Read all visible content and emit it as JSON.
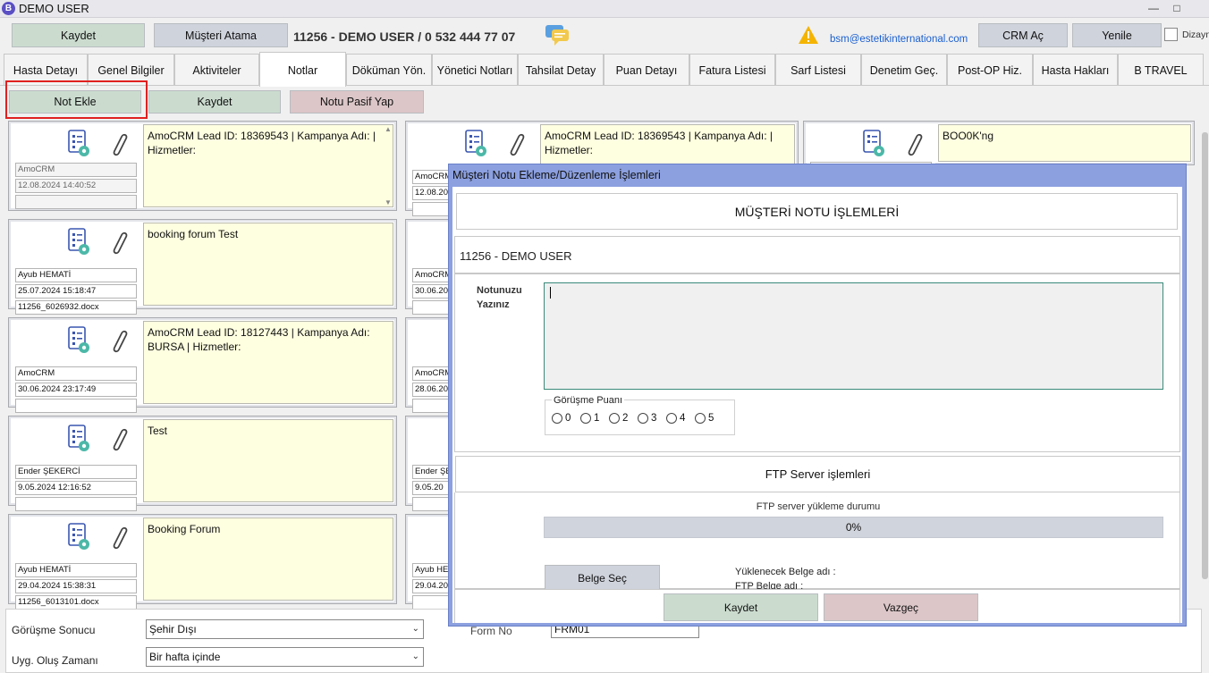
{
  "window": {
    "app_icon": "B",
    "title": "DEMO USER",
    "controls": [
      "—",
      "□"
    ]
  },
  "toolbar": {
    "save_label": "Kaydet",
    "assign_label": "Müşteri Atama",
    "patient_line": "11256  -  DEMO USER  /  0 532 444 77 07",
    "email": "bsm@estetikinternational.com",
    "crm_label": "CRM Aç",
    "refresh_label": "Yenile",
    "dizayn_label": "Dizayn"
  },
  "tabs": [
    {
      "label": "Hasta Detayı"
    },
    {
      "label": "Genel Bilgiler"
    },
    {
      "label": "Aktiviteler"
    },
    {
      "label": "Notlar",
      "active": true
    },
    {
      "label": "Döküman Yön."
    },
    {
      "label": "Yönetici Notları"
    },
    {
      "label": "Tahsilat Detay"
    },
    {
      "label": "Puan Detayı"
    },
    {
      "label": "Fatura Listesi"
    },
    {
      "label": "Sarf Listesi"
    },
    {
      "label": "Denetim Geç."
    },
    {
      "label": "Post-OP Hiz."
    },
    {
      "label": "Hasta Hakları"
    },
    {
      "label": "B TRAVEL"
    }
  ],
  "notes_toolbar": {
    "add_label": "Not Ekle",
    "save_label": "Kaydet",
    "deactivate_label": "Notu Pasif Yap"
  },
  "cards_col1": [
    {
      "author": "AmoCRM",
      "date": "12.08.2024 14:40:52",
      "file": "",
      "note": "AmoCRM Lead ID: 18369543 | Kampanya Adı:  | Hizmetler:"
    },
    {
      "author": "Ayub HEMATİ",
      "date": "25.07.2024 15:18:47",
      "file": "11256_6026932.docx",
      "note": "booking forum  Test"
    },
    {
      "author": "AmoCRM",
      "date": "30.06.2024 23:17:49",
      "file": "",
      "note": "AmoCRM Lead ID: 18127443 | Kampanya Adı: BURSA  | Hizmetler:"
    },
    {
      "author": "Ender ŞEKERCİ",
      "date": "9.05.2024 12:16:52",
      "file": "",
      "note": "Test"
    },
    {
      "author": "Ayub HEMATİ",
      "date": "29.04.2024 15:38:31",
      "file": "11256_6013101.docx",
      "note": "Booking Forum"
    }
  ],
  "cards_col2": [
    {
      "author": "AmoCRM",
      "date": "12.08.20",
      "note": "AmoCRM Lead ID: 18369543 | Kampanya Adı:  | Hizmetler:"
    },
    {
      "author": "AmoCRM",
      "date": "30.06.20",
      "note": ""
    },
    {
      "author": "AmoCRM",
      "date": "28.06.20",
      "note": ""
    },
    {
      "author": "Ender ŞEK",
      "date": "9.05.20",
      "note": ""
    },
    {
      "author": "Ayub HEM",
      "date": "29.04.20",
      "note": ""
    }
  ],
  "card_col3": {
    "note": "BOO0K'ng"
  },
  "bottom": {
    "result_label": "Görüşme Sonucu",
    "result_value": "Şehir Dışı",
    "timing_label": "Uyg. Oluş Zamanı",
    "timing_value": "Bir hafta içinde",
    "form_label": "Form No",
    "form_value": "FRM01"
  },
  "modal": {
    "title": "Müşteri Notu Ekleme/Düzenleme İşlemleri",
    "header": "MÜŞTERİ NOTU İŞLEMLERİ",
    "patient": "11256  -  DEMO USER",
    "note_label": "Notunuzu Yazınız",
    "note_value": "",
    "rating_legend": "Görüşme Puanı",
    "rating_options": [
      "0",
      "1",
      "2",
      "3",
      "4",
      "5"
    ],
    "ftp_header": "FTP Server işlemleri",
    "ftp_status_label": "FTP server yükleme durumu",
    "progress": 0,
    "progress_text": "0%",
    "select_doc_label": "Belge Seç",
    "upload_name_label": "Yüklenecek Belge adı :",
    "ftp_name_label": "FTP  Belge adı :",
    "save_label": "Kaydet",
    "cancel_label": "Vazgeç"
  },
  "icons": [
    "doc-gear-icon",
    "paperclip-icon",
    "chat-icon",
    "warning-icon"
  ],
  "colors": {
    "note_bg": "#fefee0",
    "modal_border": "#8ca0e0",
    "green_btn": "#cbdccf",
    "pink_btn": "#dcc6c8",
    "highlight": "#e02020"
  }
}
